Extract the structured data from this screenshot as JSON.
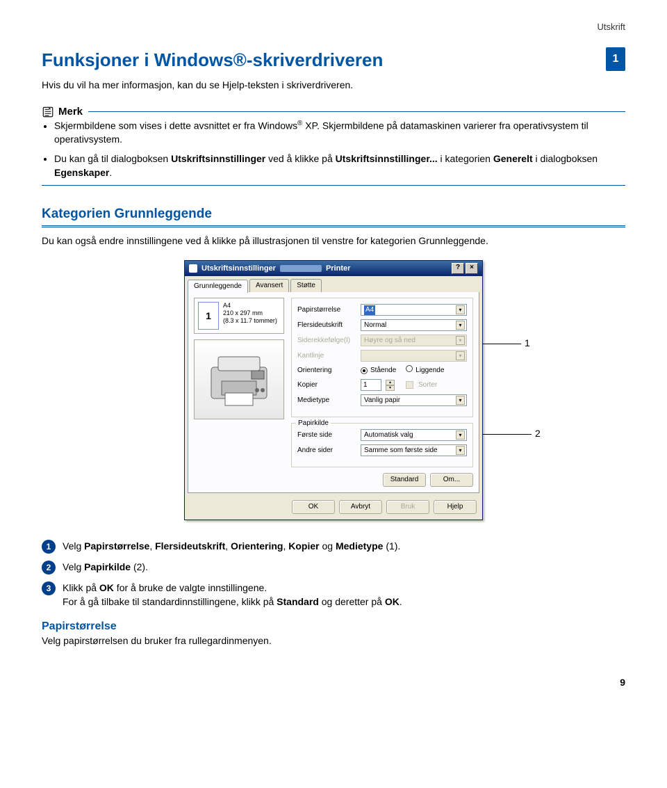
{
  "header_right": "Utskrift",
  "chapter": "1",
  "title": "Funksjoner i Windows®-skriverdriveren",
  "subtitle": "Hvis du vil ha mer informasjon, kan du se Hjelp-teksten i skriverdriveren.",
  "note_label": "Merk",
  "note_bullets": {
    "b1a": "Skjermbildene som vises i dette avsnittet er fra Windows",
    "b1b": " XP. Skjermbildene på datamaskinen varierer fra operativsystem til operativsystem.",
    "b2a": "Du kan gå til dialogboksen ",
    "b2b": "Utskriftsinnstillinger",
    "b2c": " ved å klikke på ",
    "b2d": "Utskriftsinnstillinger...",
    "b2e": " i kategorien ",
    "b2f": "Generelt",
    "b2g": " i dialogboksen ",
    "b2h": "Egenskaper",
    "b2i": "."
  },
  "section_title": "Kategorien Grunnleggende",
  "section_lead": "Du kan også endre innstillingene ved å klikke på illustrasjonen til venstre for kategorien Grunnleggende.",
  "dialog": {
    "title_left": "Utskriftsinnstillinger",
    "title_right": "Printer",
    "tabs": [
      "Grunnleggende",
      "Avansert",
      "Støtte"
    ],
    "paper": {
      "name": "A4",
      "size1": "210 x 297 mm",
      "size2": "(8.3 x 11.7 tommer)"
    },
    "thumb_number": "1",
    "fields": {
      "papirstorrelse": {
        "label": "Papirstørrelse",
        "value": "A4"
      },
      "flersideutskrift": {
        "label": "Flersideutskrift",
        "value": "Normal"
      },
      "siderekkefolge": {
        "label": "Siderekkefølge(I)",
        "value": "Høyre og så ned"
      },
      "kantlinje": {
        "label": "Kantlinje",
        "value": ""
      },
      "orientering": {
        "label": "Orientering",
        "opt1": "Stående",
        "opt2": "Liggende"
      },
      "kopier": {
        "label": "Kopier",
        "value": "1",
        "sorter": "Sorter"
      },
      "medietype": {
        "label": "Medietype",
        "value": "Vanlig papir"
      },
      "papirkilde_group": "Papirkilde",
      "forste_side": {
        "label": "Første side",
        "value": "Automatisk valg"
      },
      "andre_sider": {
        "label": "Andre sider",
        "value": "Samme som første side"
      }
    },
    "inner_buttons": {
      "standard": "Standard",
      "om": "Om..."
    },
    "footer_buttons": {
      "ok": "OK",
      "avbryt": "Avbryt",
      "bruk": "Bruk",
      "hjelp": "Hjelp"
    }
  },
  "callouts": {
    "c1": "1",
    "c2": "2"
  },
  "steps": {
    "s1a": "Velg ",
    "s1b": "Papirstørrelse",
    "s1c": ", ",
    "s1d": "Flersideutskrift",
    "s1e": ", ",
    "s1f": "Orientering",
    "s1g": ", ",
    "s1h": "Kopier",
    "s1i": " og ",
    "s1j": "Medietype",
    "s1k": " (1).",
    "s2a": "Velg ",
    "s2b": "Papirkilde",
    "s2c": " (2).",
    "s3a": "Klikk på ",
    "s3b": "OK",
    "s3c": " for å bruke de valgte innstillingene.",
    "s3d": "For å gå tilbake til standardinnstillingene, klikk på ",
    "s3e": "Standard",
    "s3f": " og deretter på ",
    "s3g": "OK",
    "s3h": "."
  },
  "subhead": "Papirstørrelse",
  "subhead_text": "Velg papirstørrelsen du bruker fra rullegardinmenyen.",
  "page_number": "9"
}
